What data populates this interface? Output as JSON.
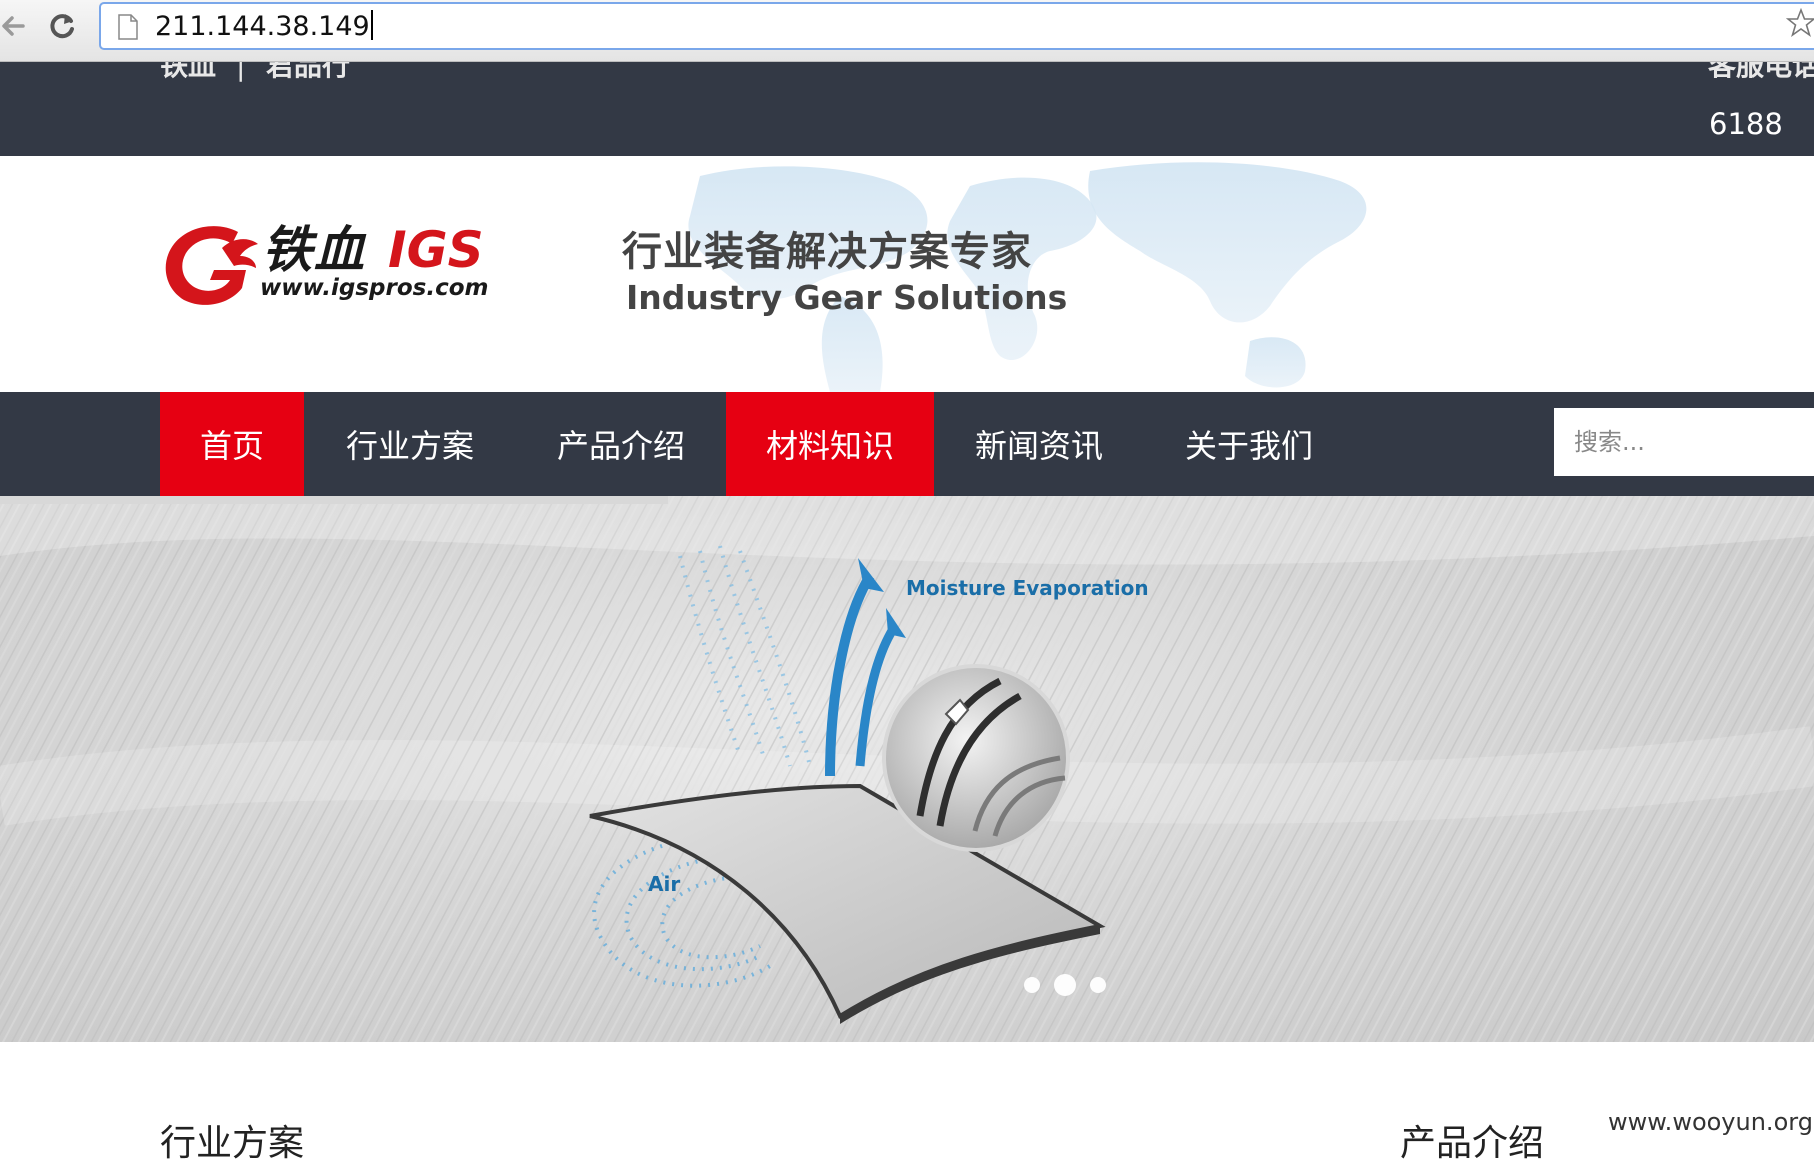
{
  "browser": {
    "url": "211.144.38.149"
  },
  "top_bar": {
    "links": [
      "铁血",
      "君品行"
    ],
    "separator": "|",
    "hotline_label": "客服电话",
    "hotline_number": "6188"
  },
  "header": {
    "brand_cn": "铁血",
    "brand_en": "IGS",
    "brand_url": "www.igspros.com",
    "slogan_cn": "行业装备解决方案专家",
    "slogan_en": "Industry Gear Solutions"
  },
  "nav": {
    "items": [
      {
        "label": "首页",
        "active": true
      },
      {
        "label": "行业方案",
        "active": false
      },
      {
        "label": "产品介绍",
        "active": false
      },
      {
        "label": "材料知识",
        "active": true
      },
      {
        "label": "新闻资讯",
        "active": false
      },
      {
        "label": "关于我们",
        "active": false
      }
    ],
    "search_placeholder": "搜索..."
  },
  "banner": {
    "label_moisture": "Moisture Evaporation",
    "label_air": "Air",
    "slide_count": 3,
    "current_slide": 2
  },
  "sections": {
    "left_title": "行业方案",
    "right_title": "产品介绍"
  },
  "watermark": "www.wooyun.org",
  "colors": {
    "nav_bg": "#333945",
    "accent_red": "#e60012",
    "banner_blue": "#1a6ea8"
  }
}
